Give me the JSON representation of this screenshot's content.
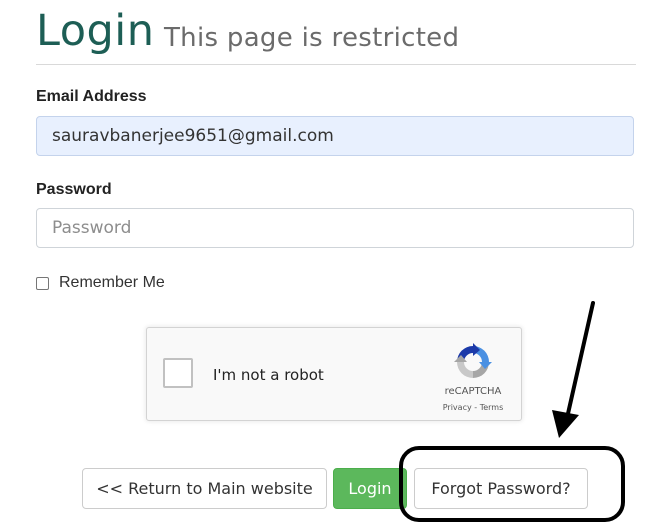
{
  "header": {
    "title": "Login",
    "subtitle": "This page is restricted"
  },
  "form": {
    "email_label": "Email Address",
    "email_value": "sauravbanerjee9651@gmail.com",
    "password_label": "Password",
    "password_placeholder": "Password",
    "remember_label": "Remember Me",
    "remember_checked": false
  },
  "captcha": {
    "label": "I'm not a robot",
    "brand": "reCAPTCHA",
    "privacy": "Privacy",
    "separator": " - ",
    "terms": "Terms",
    "icon": "recaptcha-logo-icon"
  },
  "buttons": {
    "return_label": "<< Return to Main website",
    "login_label": "Login",
    "forgot_label": "Forgot Password?"
  },
  "colors": {
    "title": "#1d5e55",
    "login_button": "#5cb85c",
    "email_fill": "#e8f0fe",
    "annotation": "#000000"
  }
}
